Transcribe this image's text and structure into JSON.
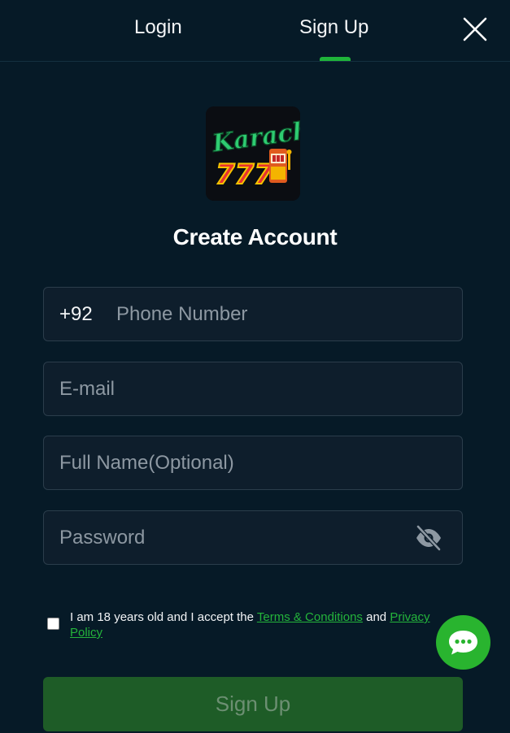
{
  "tabs": {
    "login": "Login",
    "signup": "Sign Up",
    "active": "signup"
  },
  "logo": {
    "text_top": "Karachi",
    "text_bottom": "777"
  },
  "title": "Create Account",
  "phone": {
    "prefix": "+92",
    "placeholder": "Phone Number",
    "value": ""
  },
  "email": {
    "placeholder": "E-mail",
    "value": ""
  },
  "full_name": {
    "placeholder": "Full Name(Optional)",
    "value": ""
  },
  "password": {
    "placeholder": "Password",
    "value": "",
    "toggle_icon": "eye-off-icon"
  },
  "agreement": {
    "checked": false,
    "text_before": "I am 18 years old and I accept the ",
    "terms_link": "Terms & Conditions",
    "text_and": " and ",
    "privacy_link": "Privacy Policy"
  },
  "submit_label": "Sign Up",
  "colors": {
    "background": "#061a27",
    "accent": "#1fb43a",
    "input_bg": "#0e1e2c",
    "button_bg": "#1e5c27",
    "chat_bg": "#29b42f"
  }
}
